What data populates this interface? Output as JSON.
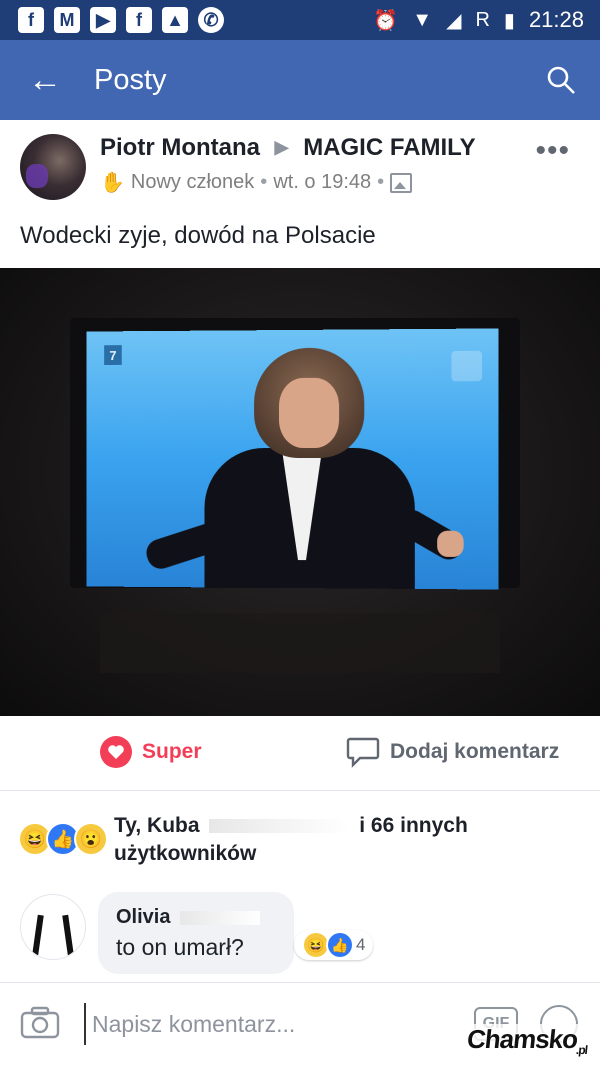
{
  "status_bar": {
    "time": "21:28",
    "carrier_flag": "R",
    "left_icons": [
      "facebook-icon",
      "gmail-icon",
      "youtube-icon",
      "facebook-icon",
      "gallery-icon",
      "whatsapp-icon"
    ],
    "right_icons": [
      "alarm-icon",
      "wifi-icon",
      "signal-icon",
      "battery-icon"
    ]
  },
  "app_bar": {
    "title": "Posty"
  },
  "post": {
    "author": "Piotr Montana",
    "group": "MAGIC FAMILY",
    "badge": "Nowy członek",
    "timestamp": "wt. o 19:48",
    "text": "Wodecki zyje, dowód na Polsacie",
    "tv_channel": "7"
  },
  "actions": {
    "reaction_label": "Super",
    "comment_label": "Dodaj komentarz",
    "reaction_color": "#f33e58"
  },
  "reactions": {
    "line1_start": "Ty, Kuba",
    "line1_end": "i 66 innych",
    "line2": "użytkowników"
  },
  "comment": {
    "author": "Olivia",
    "text": "to on umarł?",
    "reaction_count": "4"
  },
  "composer": {
    "placeholder": "Napisz komentarz...",
    "gif_label": "GIF"
  },
  "watermark": {
    "text": "Chamsko",
    "suffix": ".pl"
  },
  "colors": {
    "status_bar": "#1f3d77",
    "app_bar": "#4267b2",
    "accent": "#4267b2"
  }
}
